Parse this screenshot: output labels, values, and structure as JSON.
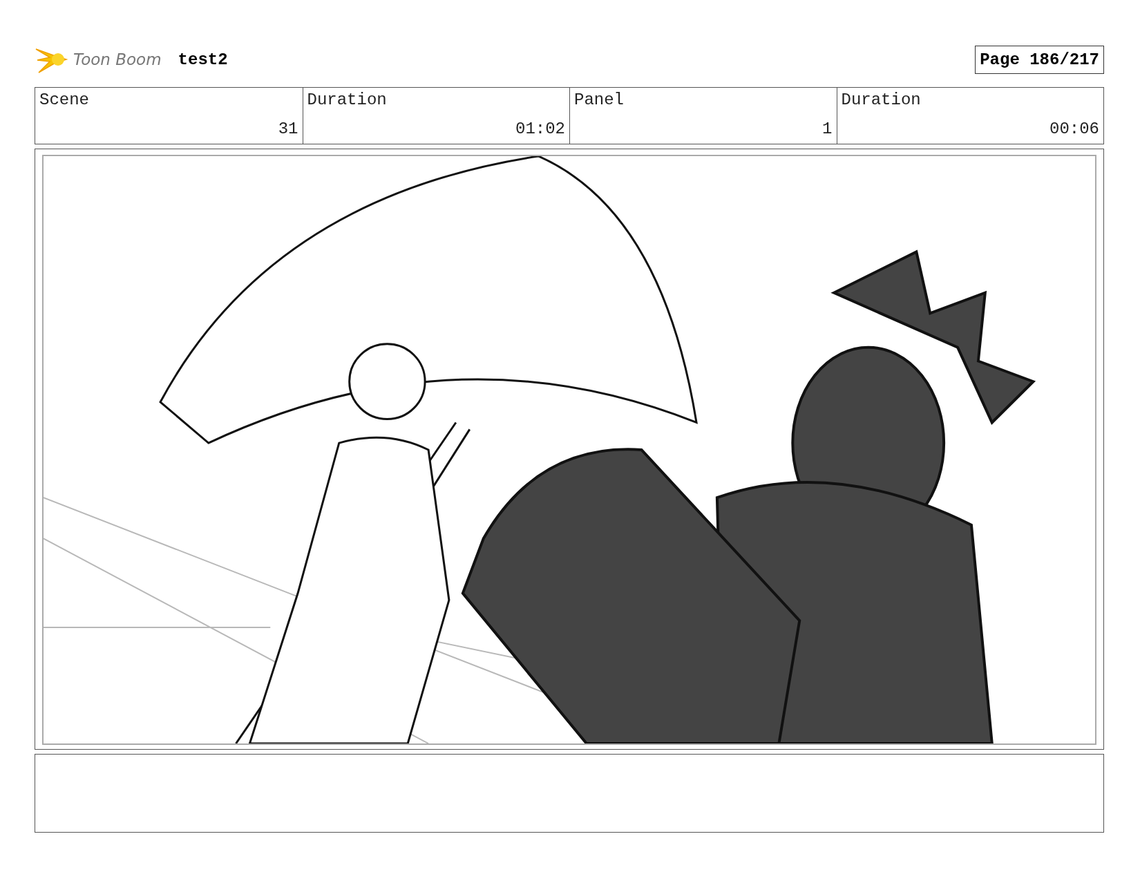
{
  "header": {
    "logo": "Toon Boom",
    "title": "test2",
    "page": "Page 186/217"
  },
  "table": {
    "columns": [
      "Scene",
      "Duration",
      "Panel",
      "Duration"
    ],
    "rows": [
      [
        "31",
        "01:02",
        "1",
        "00:06"
      ]
    ]
  }
}
